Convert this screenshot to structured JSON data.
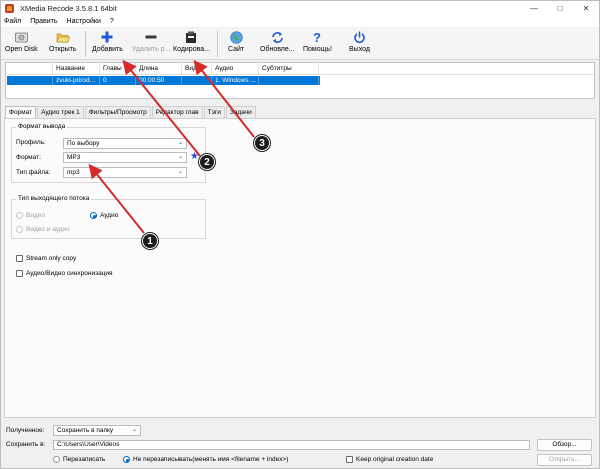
{
  "window": {
    "title": "XMedia Recode 3.5.8.1 64bit",
    "controls": [
      "—",
      "□",
      "✕"
    ]
  },
  "menu": [
    "Файл",
    "Править",
    "Настройки",
    "?"
  ],
  "toolbar": {
    "open_disk": "Open Disk",
    "open": "Открыть",
    "add": "Добавить",
    "remove": "Удалить р...",
    "encode": "Кодирова...",
    "site": "Сайт",
    "update": "Обновле...",
    "help": "Помощь!",
    "exit": "Выход"
  },
  "filelist": {
    "columns": [
      "",
      "Название",
      "Главы",
      "Длина",
      "Видео",
      "Аудио",
      "Субтитры"
    ],
    "row": [
      "",
      "zvuki-prirod...",
      "0",
      "00:00:50",
      "",
      "1. Windows ...",
      ""
    ]
  },
  "tabs": [
    "Формат",
    "Аудио трек 1",
    "Фильтры/Просмотр",
    "Редактор глав",
    "Тэги",
    "Задачи"
  ],
  "format": {
    "group_title": "Формат вывода",
    "profile_label": "Профиль:",
    "profile_value": "По выбору",
    "format_label": "Формат:",
    "format_value": "MP3",
    "filetype_label": "Тип файла:",
    "filetype_value": "mp3"
  },
  "stream": {
    "group_title": "Тип выходящего потока",
    "video": "Видео",
    "audio": "Аудио",
    "video_audio": "Видео и аудио"
  },
  "options": {
    "stream_only_copy": "Stream only copy",
    "av_sync": "Аудио/Видео синхронизация"
  },
  "bottom": {
    "received_label": "Полученное:",
    "received_value": "Сохранить в папку",
    "saveto_label": "Сохранить в:",
    "saveto_value": "C:\\Users\\User\\Videos",
    "browse": "Обзор...",
    "overwrite": "Перезаписать",
    "no_overwrite": "Не перезаписывать(менять имя <filename + index>)",
    "keep_date": "Keep original creation date",
    "open": "Открыть..."
  },
  "annotations": [
    "1",
    "2",
    "3"
  ],
  "colors": {
    "selection": "#0078d7",
    "arrow": "#d42a2a",
    "accent": "#2b4fd6"
  }
}
